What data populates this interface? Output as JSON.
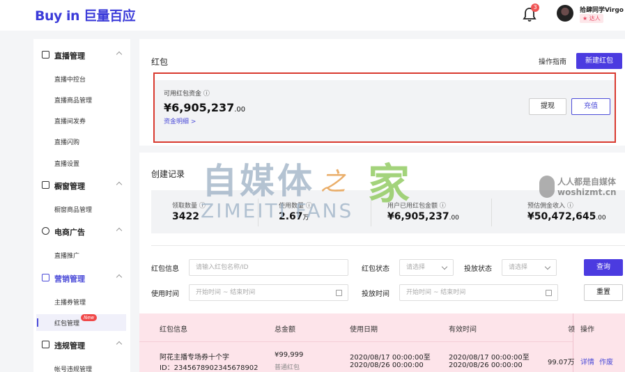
{
  "header": {
    "logo": "Buy in 巨量百应",
    "notification_count": "3",
    "username": "拾肆同学Virgo",
    "role_badge": "★ 达人"
  },
  "sidebar": {
    "groups": [
      {
        "label": "直播管理",
        "items": [
          "直播中控台",
          "直播商品管理",
          "直播间发券",
          "直播闪购",
          "直播设置"
        ]
      },
      {
        "label": "橱窗管理",
        "items": [
          "橱窗商品管理"
        ]
      },
      {
        "label": "电商广告",
        "items": [
          "直播推广"
        ]
      },
      {
        "label": "营销管理",
        "items": [
          "主播券管理",
          "红包管理"
        ]
      },
      {
        "label": "违规管理",
        "items": [
          "帐号违规管理"
        ]
      }
    ],
    "new_badge": "New"
  },
  "redpacket": {
    "title": "红包",
    "guide": "操作指南",
    "create_button": "新建红包",
    "fund_label": "可用红包资金 ⓘ",
    "currency": "¥",
    "fund_amount": "6,905,237",
    "fund_decimals": ".00",
    "fund_detail_link": "资金明细 >",
    "withdraw_button": "提现",
    "recharge_button": "充值"
  },
  "records": {
    "title": "创建记录",
    "stats": [
      {
        "label": "领取数量 ⓘ",
        "value": "3422",
        "suffix": ""
      },
      {
        "label": "使用数量 ⓘ",
        "value": "2.67",
        "suffix": "万"
      },
      {
        "label": "用户已用红包金额 ⓘ",
        "value": "¥6,905,237",
        "suffix": ".00"
      },
      {
        "label": "预估佣金收入 ⓘ",
        "value": "¥50,472,645",
        "suffix": ".00"
      }
    ]
  },
  "filters": {
    "info_label": "红包信息",
    "info_placeholder": "请输入红包名称/ID",
    "status_label": "红包状态",
    "status_placeholder": "请选择",
    "delivery_label": "投放状态",
    "delivery_placeholder": "请选择",
    "use_time_label": "使用时间",
    "delivery_time_label": "投放时间",
    "time_range": "开始时间  ~  结束时间",
    "query_button": "查询",
    "reset_button": "重置"
  },
  "table": {
    "headers": [
      "红包信息",
      "总金额",
      "使用日期",
      "有效时间",
      "领",
      "操作"
    ],
    "rows": [
      {
        "name": "阿花主播专场券十个字",
        "id": "ID：2345678902345678902",
        "amount": "¥99,999",
        "type": "普通红包",
        "use_start": "2020/08/17 00:00:00至",
        "use_end": "2020/08/26 00:00:00",
        "valid_start": "2020/08/17 00:00:00至",
        "valid_end": "2020/08/26 00:00:00",
        "claimed": "99.07万",
        "actions": [
          "详情",
          "作废"
        ]
      }
    ]
  },
  "watermark": {
    "cn": "自媒体",
    "zhi": "之",
    "jia": "家",
    "en": "ZIMEITI FANS",
    "site_cn": "人人都是自媒体",
    "site_en": "woshizmt.cn"
  }
}
